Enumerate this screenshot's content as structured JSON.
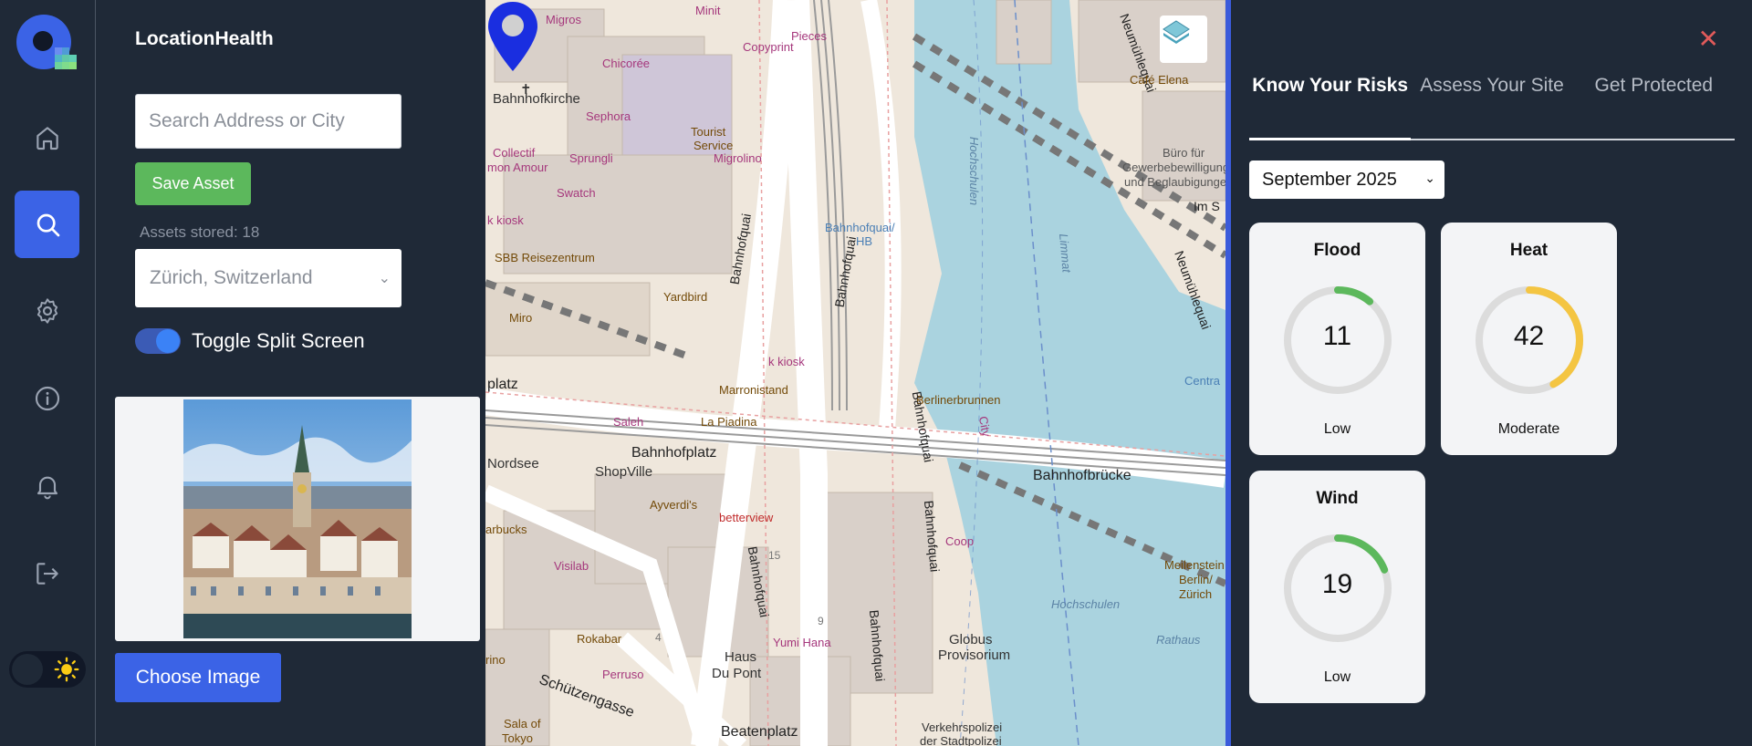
{
  "app": {
    "title": "LocationHealth"
  },
  "rail": {
    "items": [
      {
        "name": "home",
        "icon": "home-icon"
      },
      {
        "name": "search",
        "icon": "search-icon",
        "active": true
      },
      {
        "name": "settings",
        "icon": "gear-icon"
      },
      {
        "name": "info",
        "icon": "info-icon"
      },
      {
        "name": "notifications",
        "icon": "bell-icon"
      },
      {
        "name": "logout",
        "icon": "logout-icon"
      }
    ],
    "theme_icon": "sun-icon"
  },
  "panel": {
    "search_placeholder": "Search Address or City",
    "save_label": "Save Asset",
    "assets_stored": "Assets stored: 18",
    "city_selected": "Zürich, Switzerland",
    "split_label": "Toggle Split Screen",
    "choose_label": "Choose Image"
  },
  "map": {
    "labels": {
      "bahnhofkirche": "Bahnhofkirche",
      "sephora": "Sephora",
      "tourist": "Tourist",
      "service": "Service",
      "sprungli": "Sprungli",
      "migrolino": "Migrolino",
      "swatch": "Swatch",
      "collectif": "Collectif",
      "mon_amour": "mon Amour",
      "kkiosk": "k kiosk",
      "sbb": "SBB Reisezentrum",
      "yardbird": "Yardbird",
      "miro": "Miro",
      "marronistand": "Marronistand",
      "kkiosk2": "k kiosk",
      "saleh": "Saleh",
      "la_piadina": "La Piadina",
      "berlinerbrunnen": "Berlinerbrunnen",
      "bahnhofplatz": "Bahnhofplatz",
      "bahnhofplatz2": "Bahnhofplatz",
      "shopville": "ShopVille",
      "nordsee": "Nordsee",
      "bahnhofbrucke": "Bahnhofbrücke",
      "ayverdis": "Ayverdi's",
      "betterview": "betterview",
      "coop": "Coop",
      "visilab": "Visilab",
      "rokabar": "Rokabar",
      "perruso": "Perruso",
      "yumi_hana": "Yumi Hana",
      "haus": "Haus",
      "du_pont": "Du Pont",
      "globus": "Globus",
      "provisorium": "Provisorium",
      "schutzengasse": "Schützengasse",
      "beatenplatz": "Beatenplatz",
      "hochschulen": "Hochschulen",
      "hochschulen2": "Hochschulen",
      "limmat": "Limmat",
      "bahnhofquai": "Bahnhofquai",
      "neumuhlequai": "Neumühlequai",
      "cafe_elena": "Café Elena",
      "buro_fur": "Büro für",
      "gewerbe": "Gewerbebewilligungen",
      "beglaubigungen": "und Beglaubigungen",
      "im_s": "Im S",
      "centra": "Centra",
      "meilenstein": "Meilenstein",
      "berlin_zurich": "Berlin/",
      "zurich": "Zürich",
      "rathaus": "Rathaus",
      "verkehrspolizei": "Verkehrspolizei",
      "stadtpolizei": "der Stadtpolizei",
      "migros": "Migros",
      "minit": "Minit",
      "copyprint": "Copyprint",
      "pieces": "Pieces",
      "chicoree": "Chicorée",
      "kabaz_hb": "Bahnhofquai/",
      "hb": "HB",
      "sala_of": "Sala of",
      "tokyo": "Tokyo",
      "arbucks": "arbucks",
      "rino": "rino",
      "fifteen": "15",
      "nine": "9",
      "four": "4",
      "platz_left": "platz",
      "city": "City"
    }
  },
  "right": {
    "tabs": [
      "Know Your Risks",
      "Assess Your Site",
      "Get Protected"
    ],
    "month": "September 2025",
    "risks": [
      {
        "title": "Flood",
        "value": 11,
        "level": "Low",
        "color": "#5cb85c"
      },
      {
        "title": "Heat",
        "value": 42,
        "level": "Moderate",
        "color": "#f4c542"
      },
      {
        "title": "Wind",
        "value": 19,
        "level": "Low",
        "color": "#5cb85c"
      }
    ]
  },
  "colors": {
    "accent": "#3b63e6",
    "save": "#5cb85c",
    "close": "#e05a5a"
  }
}
